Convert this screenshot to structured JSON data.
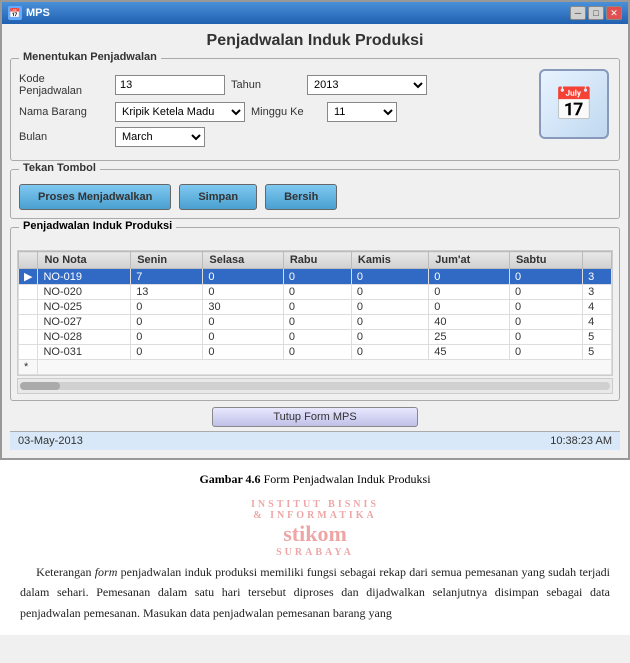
{
  "window": {
    "title": "MPS",
    "icon": "📅"
  },
  "main_title": "Penjadwalan Induk Produksi",
  "form": {
    "menentukan_label": "Menentukan Penjadwalan",
    "kode_label": "Kode Penjadwalan",
    "kode_value": "13",
    "tahun_label": "Tahun",
    "tahun_value": "2013",
    "nama_label": "Nama Barang",
    "nama_value": "Kripik Ketela Madu",
    "minggu_label": "Minggu Ke",
    "minggu_value": "11",
    "bulan_label": "Bulan",
    "bulan_value": "March",
    "tekan_label": "Tekan Tombol",
    "btn_proses": "Proses Menjadwalkan",
    "btn_simpan": "Simpan",
    "btn_bersih": "Bersih"
  },
  "table": {
    "legend": "Penjadwalan Induk Produksi",
    "columns": [
      "",
      "No Nota",
      "Senin",
      "Selasa",
      "Rabu",
      "Kamis",
      "Jum'at",
      "Sabtu",
      ""
    ],
    "rows": [
      {
        "pointer": true,
        "no_nota": "NO-019",
        "senin": "7",
        "selasa": "0",
        "rabu": "0",
        "kamis": "0",
        "jumat": "0",
        "sabtu": "0",
        "extra": "3",
        "selected": true
      },
      {
        "pointer": false,
        "no_nota": "NO-020",
        "senin": "13",
        "selasa": "0",
        "rabu": "0",
        "kamis": "0",
        "jumat": "0",
        "sabtu": "0",
        "extra": "3"
      },
      {
        "pointer": false,
        "no_nota": "NO-025",
        "senin": "0",
        "selasa": "30",
        "rabu": "0",
        "kamis": "0",
        "jumat": "0",
        "sabtu": "0",
        "extra": "4"
      },
      {
        "pointer": false,
        "no_nota": "NO-027",
        "senin": "0",
        "selasa": "0",
        "rabu": "0",
        "kamis": "0",
        "jumat": "40",
        "sabtu": "0",
        "extra": "4"
      },
      {
        "pointer": false,
        "no_nota": "NO-028",
        "senin": "0",
        "selasa": "0",
        "rabu": "0",
        "kamis": "0",
        "jumat": "25",
        "sabtu": "0",
        "extra": "5"
      },
      {
        "pointer": false,
        "no_nota": "NO-031",
        "senin": "0",
        "selasa": "0",
        "rabu": "0",
        "kamis": "0",
        "jumat": "45",
        "sabtu": "0",
        "extra": "5"
      }
    ],
    "new_row_marker": "*"
  },
  "close_btn_label": "Tutup Form MPS",
  "status_bar": {
    "date": "03-May-2013",
    "time": "10:38:23 AM"
  },
  "figure_caption": "Gambar 4.6",
  "figure_caption_text": "Form Penjadwalan Induk Produksi",
  "paragraph1": "Keterangan form penjadwalan induk produksi memiliki fungsi sebagai rekap dari semua pemesanan yang sudah terjadi dalam sehari. Pemesanan dalam satu hari tersebut diproses dan dijadwalkan selanjutnya disimpan sebagai data penjadwalan pemesanan. Masukan data penjadwalan pemesanan barang yang",
  "watermark_lines": [
    "INSTITUT BISNIS",
    "& INFORMATIKA"
  ],
  "stikom_text": "stikom",
  "surabaya_text": "SURABAYA"
}
